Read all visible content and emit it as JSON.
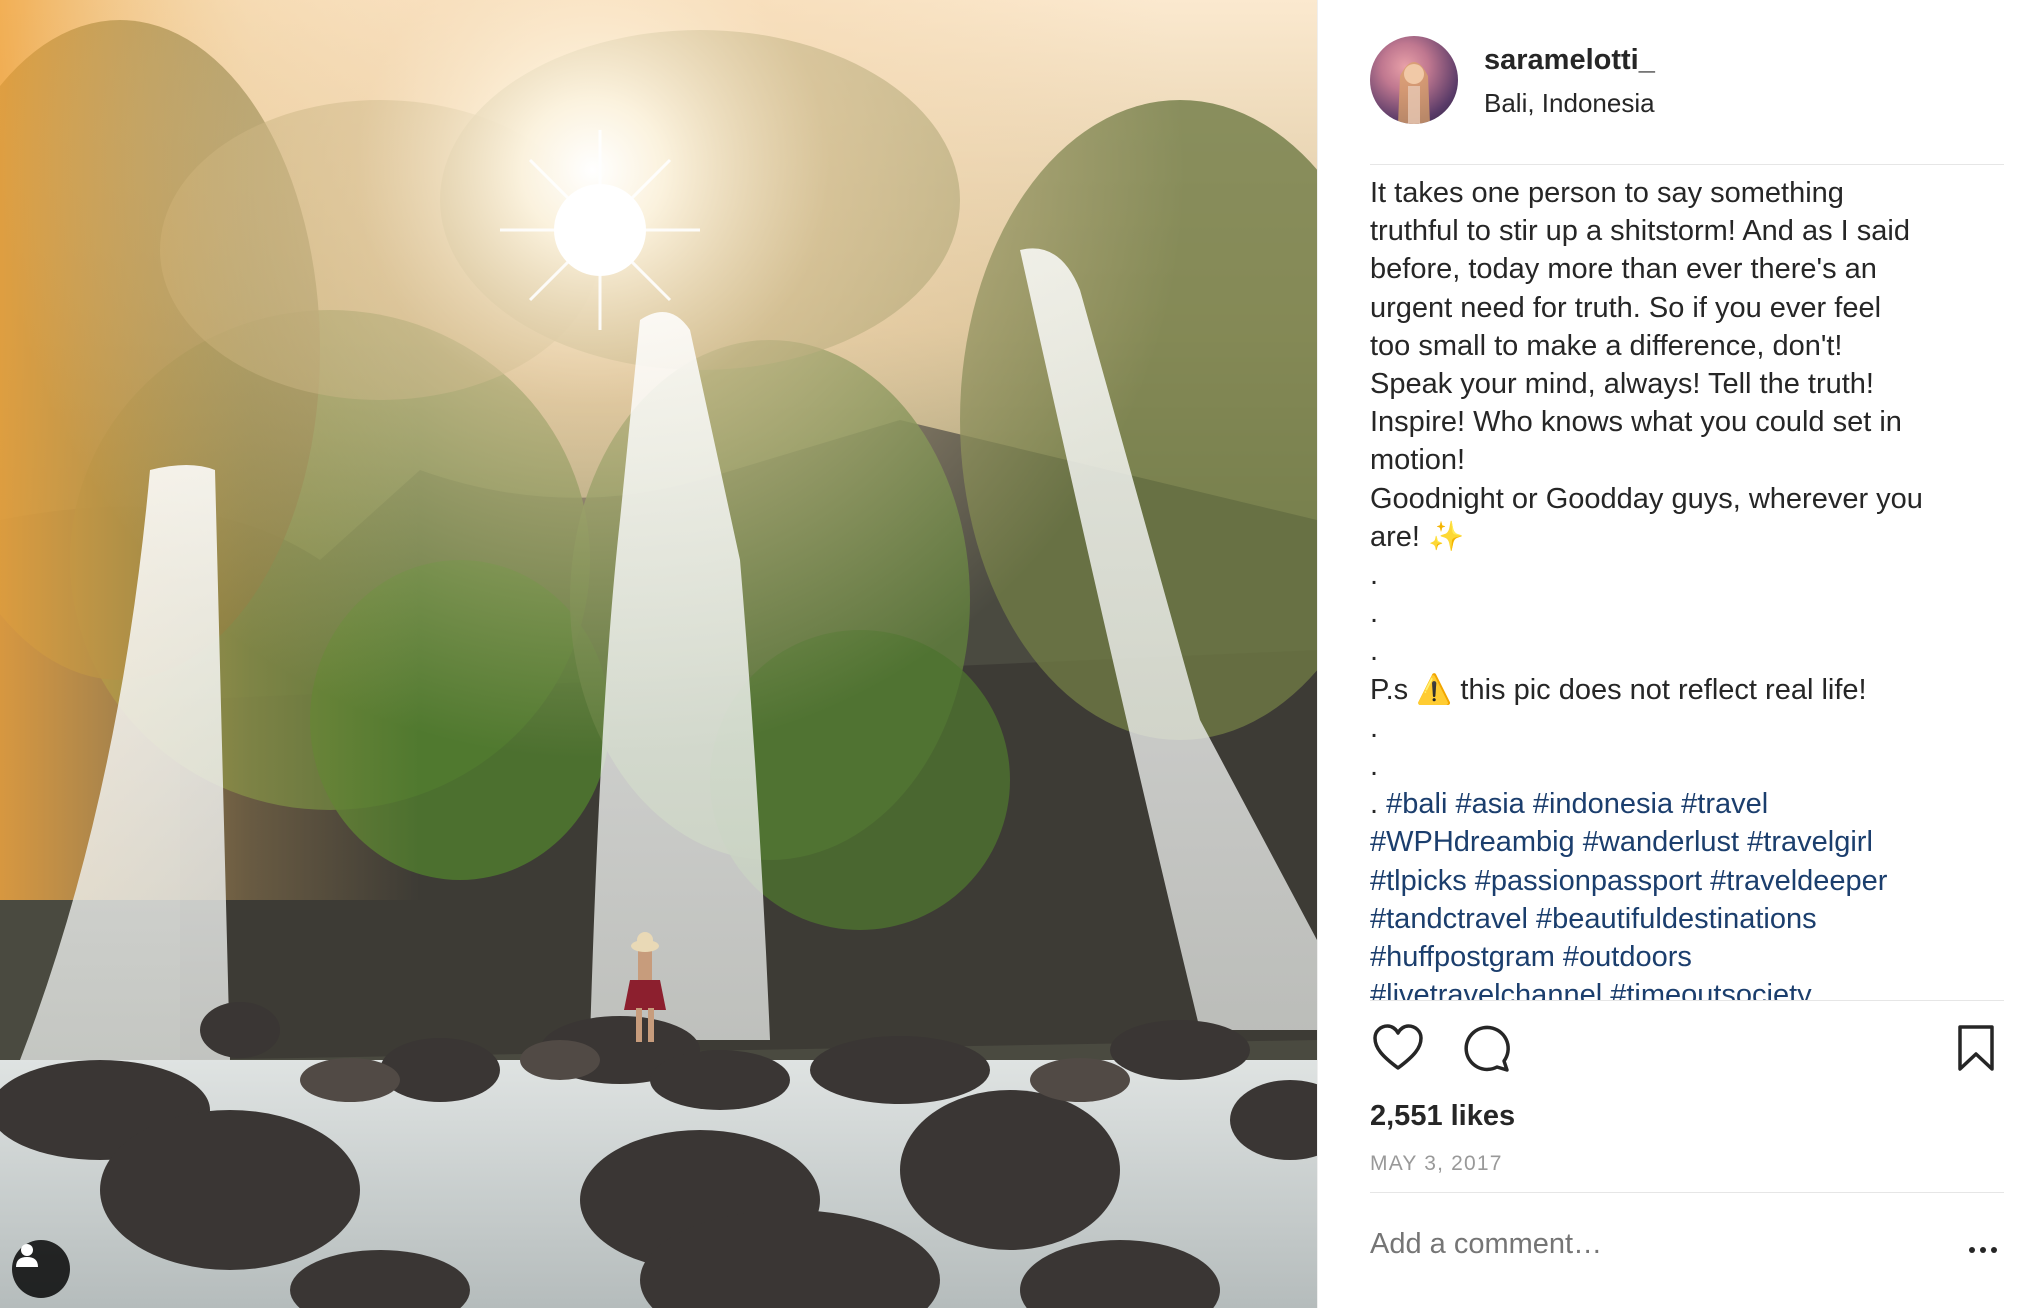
{
  "post": {
    "username": "saramelotti_",
    "location": "Bali, Indonesia",
    "caption_lines": [
      "It takes one person to say something",
      "truthful to stir up a shitstorm! And as I said",
      "before, today more than ever there's an",
      "urgent need for truth. So if you ever feel",
      "too small to make a difference, don't!",
      "Speak your mind, always! Tell the truth!",
      "Inspire! Who knows what you could set in",
      "motion!",
      "Goodnight or Goodday guys, wherever you",
      "are! ✨",
      ".",
      ".",
      ".",
      "P.s ⚠️ this pic does not reflect real life!",
      ".",
      "."
    ],
    "hashtag_lead": ". ",
    "hashtag_lines": [
      "#bali #asia #indonesia #travel",
      "#WPHdreambig #wanderlust #travelgirl",
      "#tlpicks #passionpassport #traveldeeper",
      "#tandctravel #beautifuldestinations",
      "#huffpostgram #outdoors",
      "#livetravelchannel #timeoutsociety"
    ],
    "likes": "2,551 likes",
    "date": "MAY 3, 2017",
    "comment_placeholder": "Add a comment…"
  },
  "icons": {
    "like": "heart-outline-icon",
    "comment": "speech-bubble-icon",
    "save": "bookmark-outline-icon",
    "more": "ellipsis-icon",
    "tag": "user-silhouette-icon"
  },
  "colors": {
    "text": "#262626",
    "hashtag": "#1b3e6d",
    "muted": "#999999",
    "divider": "#e6e6e6"
  }
}
